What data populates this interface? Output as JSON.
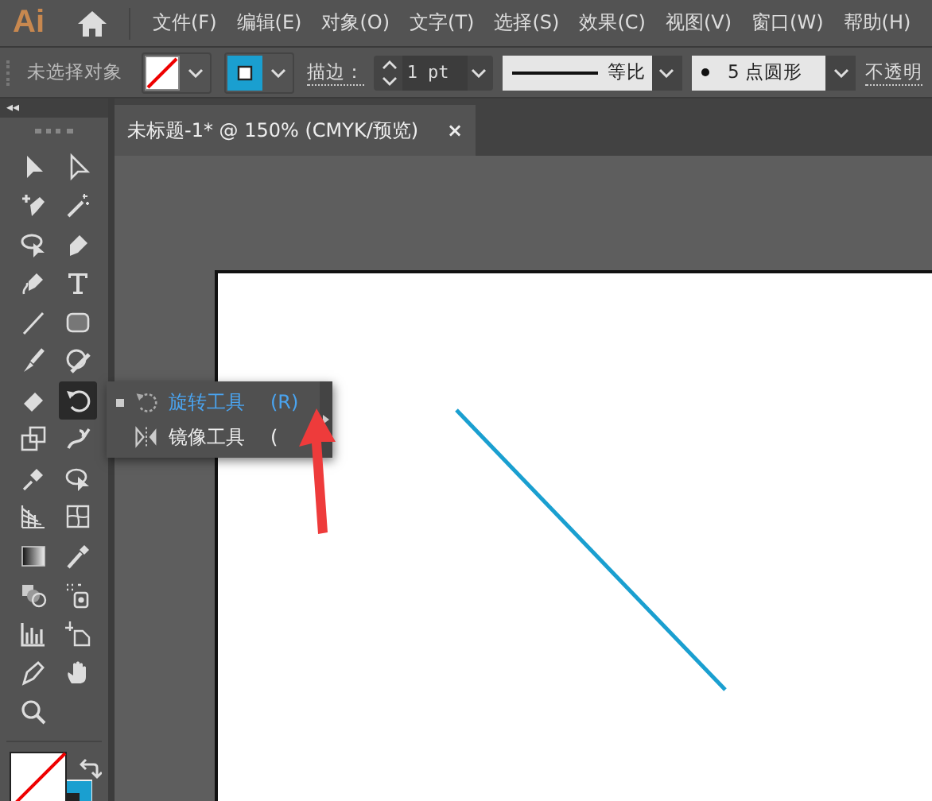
{
  "app": {
    "logo": "Ai"
  },
  "menu": [
    "文件(F)",
    "编辑(E)",
    "对象(O)",
    "文字(T)",
    "选择(S)",
    "效果(C)",
    "视图(V)",
    "窗口(W)",
    "帮助(H)"
  ],
  "control_bar": {
    "selection_status": "未选择对象",
    "stroke_label": "描边：",
    "stroke_weight": "1 pt",
    "variable_width": "等比",
    "brush": "5 点圆形",
    "opacity_label": "不透明"
  },
  "toolbar": {
    "collapse": "◂◂",
    "tools": [
      {
        "selected": false
      },
      {
        "selected": false
      },
      {
        "selected": false
      },
      {
        "selected": false
      },
      {
        "selected": false
      },
      {
        "selected": false
      },
      {
        "selected": false
      },
      {
        "selected": false
      },
      {
        "selected": false
      },
      {
        "selected": false
      },
      {
        "selected": false
      },
      {
        "selected": false
      },
      {
        "selected": false
      },
      {
        "selected": true
      },
      {
        "selected": false
      },
      {
        "selected": false
      },
      {
        "selected": false
      },
      {
        "selected": false
      },
      {
        "selected": false
      },
      {
        "selected": false
      },
      {
        "selected": false
      },
      {
        "selected": false
      },
      {
        "selected": false
      },
      {
        "selected": false
      },
      {
        "selected": false
      },
      {
        "selected": false
      },
      {
        "selected": false
      },
      {
        "selected": false
      },
      {
        "selected": false
      }
    ]
  },
  "document_tab": {
    "title": "未标题-1* @ 150% (CMYK/预览)",
    "close": "×"
  },
  "flyout": {
    "items": [
      {
        "label": "旋转工具",
        "shortcut": "(R)",
        "selected": true
      },
      {
        "label": "镜像工具",
        "shortcut": "(",
        "selected": false
      }
    ]
  }
}
